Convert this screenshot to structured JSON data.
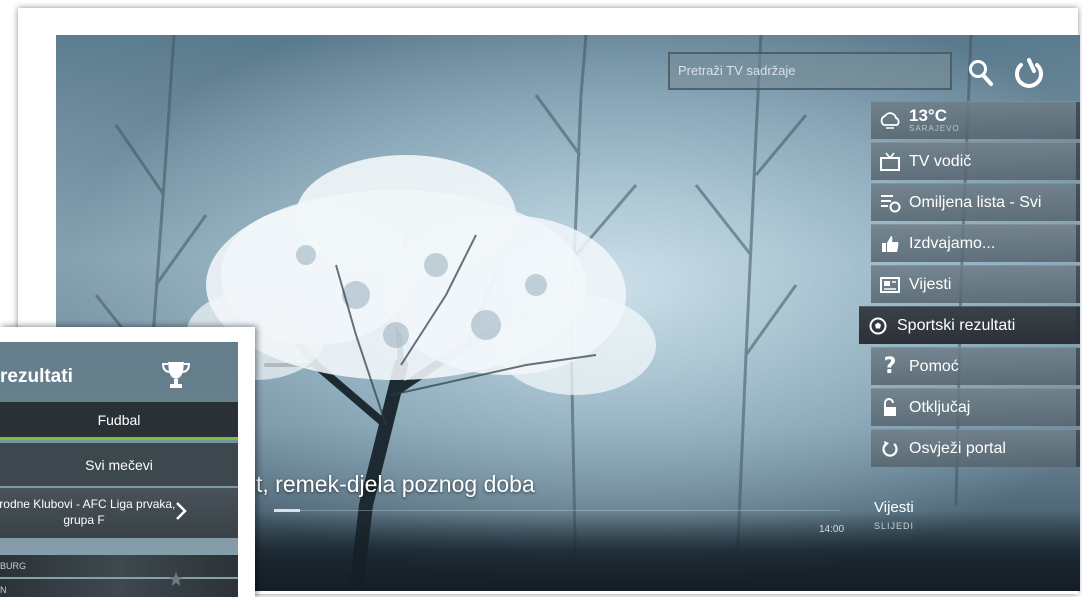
{
  "search": {
    "placeholder": "Pretraži TV sadržaje"
  },
  "weather": {
    "temperature": "13°C",
    "city": "SARAJEVO"
  },
  "menu": {
    "items": [
      {
        "label": "TV vodič",
        "icon": "tv-icon"
      },
      {
        "label": "Omiljena lista - Svi",
        "icon": "favorites-list-icon"
      },
      {
        "label": "Izdvajamo...",
        "icon": "thumbs-up-icon"
      },
      {
        "label": "Vijesti",
        "icon": "news-icon"
      },
      {
        "label": "Sportski rezultati",
        "icon": "soccer-ball-icon",
        "active": true
      },
      {
        "label": "Pomoć",
        "icon": "help-icon"
      },
      {
        "label": "Otključaj",
        "icon": "unlock-icon"
      },
      {
        "label": "Osvježi portal",
        "icon": "refresh-icon"
      }
    ]
  },
  "now_playing": {
    "title": "t, remek-djela poznog doba",
    "time": "14:00",
    "next_title": "Vijesti",
    "next_label": "SLIJEDI"
  },
  "sports_panel": {
    "title": "rezultati",
    "sport_tab": "Fudbal",
    "filter_tab": "Svi mečevi",
    "league": "arodne Klubovi - AFC Liga prvaka, grupa F",
    "teams": [
      "BURG",
      "N"
    ]
  },
  "colors": {
    "accent_green": "#7cbf3f",
    "menu_active": "#2b3136"
  }
}
